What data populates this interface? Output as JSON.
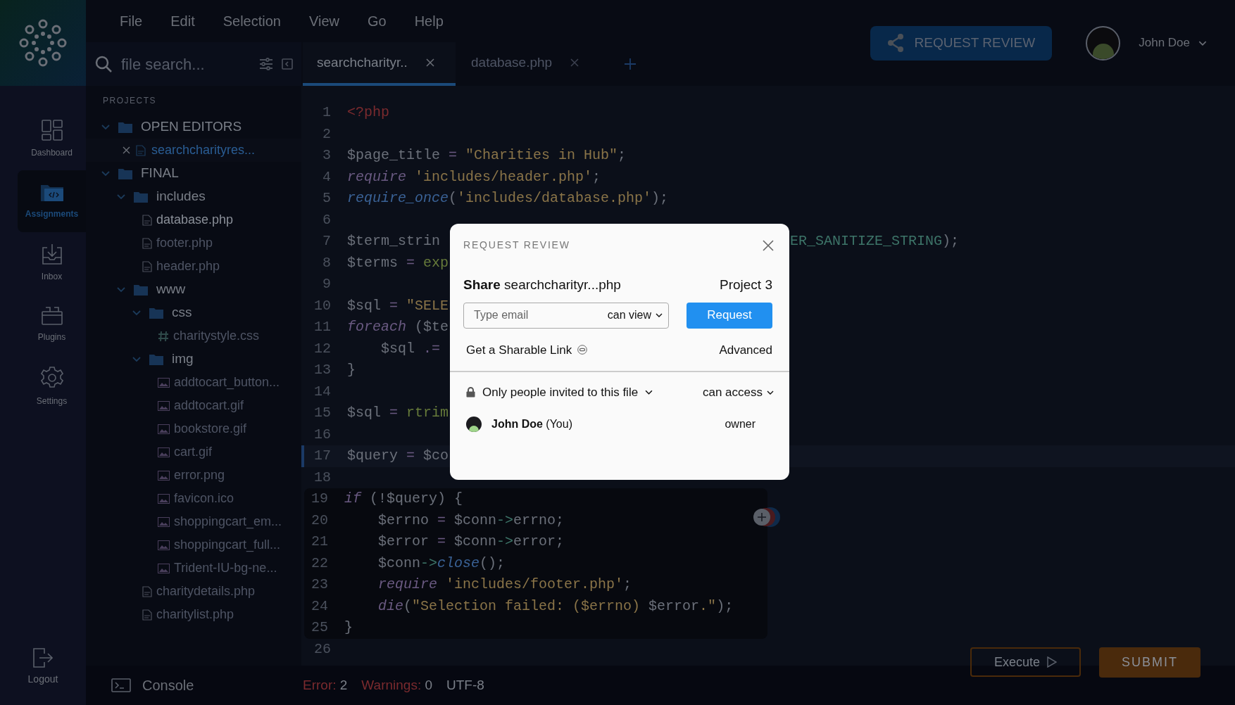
{
  "nav": {
    "items": [
      {
        "label": "Dashboard",
        "selected": false
      },
      {
        "label": "Assignments",
        "selected": true
      },
      {
        "label": "Inbox",
        "selected": false
      },
      {
        "label": "Plugins",
        "selected": false
      },
      {
        "label": "Settings",
        "selected": false
      }
    ],
    "logout": "Logout"
  },
  "menu": [
    "File",
    "Edit",
    "Selection",
    "View",
    "Go",
    "Help"
  ],
  "header": {
    "request_button": "REQUEST REVIEW",
    "user_name": "John Doe"
  },
  "search": {
    "placeholder": "file search..."
  },
  "tabs": [
    {
      "label": "searchcharityr..",
      "selected": true
    },
    {
      "label": "database.php",
      "selected": false
    }
  ],
  "tree": {
    "heading": "PROJECTS",
    "items": [
      {
        "kind": "folder",
        "label": "OPEN EDITORS",
        "expanded": true,
        "children": [
          {
            "kind": "open_editor",
            "label": "searchcharityres...",
            "selected": true
          }
        ]
      },
      {
        "kind": "folder",
        "label": "FINAL",
        "expanded": true,
        "children": [
          {
            "kind": "folder",
            "label": "includes",
            "expanded": true,
            "children": [
              {
                "kind": "php",
                "label": "database.php",
                "bright": true
              },
              {
                "kind": "php",
                "label": "footer.php",
                "bright": false
              },
              {
                "kind": "php",
                "label": "header.php",
                "bright": false
              }
            ]
          },
          {
            "kind": "folder",
            "label": "www",
            "expanded": true,
            "children": [
              {
                "kind": "folder",
                "label": "css",
                "expanded": true,
                "children": [
                  {
                    "kind": "css",
                    "label": "charitystyle.css",
                    "bright": false
                  }
                ]
              },
              {
                "kind": "folder",
                "label": "img",
                "expanded": true,
                "children": [
                  {
                    "kind": "image",
                    "label": "addtocart_button...",
                    "bright": false
                  },
                  {
                    "kind": "image",
                    "label": "addtocart.gif",
                    "bright": false
                  },
                  {
                    "kind": "image",
                    "label": "bookstore.gif",
                    "bright": false
                  },
                  {
                    "kind": "image",
                    "label": "cart.gif",
                    "bright": false
                  },
                  {
                    "kind": "image",
                    "label": "error.png",
                    "bright": false
                  },
                  {
                    "kind": "image",
                    "label": "favicon.ico",
                    "bright": false
                  },
                  {
                    "kind": "image",
                    "label": "shoppingcart_em...",
                    "bright": false
                  },
                  {
                    "kind": "image",
                    "label": "shoppingcart_full...",
                    "bright": false
                  },
                  {
                    "kind": "image",
                    "label": "Trident-IU-bg-ne...",
                    "bright": false
                  }
                ]
              },
              {
                "kind": "php",
                "label": "charitydetails.php",
                "bright": false
              },
              {
                "kind": "php",
                "label": "charitylist.php",
                "bright": false
              }
            ]
          }
        ]
      }
    ]
  },
  "code": [
    {
      "number": "1",
      "tokens": [
        {
          "kind": "tag",
          "text": "<?php"
        }
      ]
    },
    {
      "number": "2"
    },
    {
      "number": "3",
      "tokens": [
        {
          "kind": "var",
          "text": "$page_title"
        },
        {
          "kind": "op",
          "text": " ="
        },
        {
          "kind": "str",
          "text": " \"Charities in Hub\""
        },
        {
          "kind": "plain",
          "text": ";"
        }
      ]
    },
    {
      "number": "4",
      "tokens": [
        {
          "kind": "kw",
          "text": "require"
        },
        {
          "kind": "str",
          "text": " 'includes/header.php'"
        },
        {
          "kind": "plain",
          "text": ";"
        }
      ]
    },
    {
      "number": "5",
      "tokens": [
        {
          "kind": "fn",
          "text": "require_once"
        },
        {
          "kind": "plain",
          "text": "("
        },
        {
          "kind": "str",
          "text": "'includes/database.php'"
        },
        {
          "kind": "plain",
          "text": ");"
        }
      ]
    },
    {
      "number": "6"
    },
    {
      "number": "7",
      "tokens": [
        {
          "kind": "var",
          "text": "$term_strin"
        }
      ],
      "right_tokens": [
        {
          "kind": "const",
          "text": "ER_SANITIZE_STRING"
        },
        {
          "kind": "plain",
          "text": ");"
        }
      ]
    },
    {
      "number": "8",
      "tokens": [
        {
          "kind": "var",
          "text": "$terms"
        },
        {
          "kind": "op",
          "text": " ="
        },
        {
          "kind": "call",
          "text": " exp"
        }
      ]
    },
    {
      "number": "9"
    },
    {
      "number": "10",
      "tokens": [
        {
          "kind": "var",
          "text": "$sql"
        },
        {
          "kind": "op",
          "text": " ="
        },
        {
          "kind": "str",
          "text": " \"SELE"
        }
      ]
    },
    {
      "number": "11",
      "tokens": [
        {
          "kind": "kw",
          "text": "foreach"
        },
        {
          "kind": "plain",
          "text": " ($te"
        }
      ]
    },
    {
      "number": "12",
      "indented": true,
      "tokens": [
        {
          "kind": "var",
          "text": "$sql"
        },
        {
          "kind": "op",
          "text": " .="
        }
      ]
    },
    {
      "number": "13",
      "tokens": [
        {
          "kind": "plain",
          "text": "}"
        }
      ]
    },
    {
      "number": "14"
    },
    {
      "number": "15",
      "tokens": [
        {
          "kind": "var",
          "text": "$sql"
        },
        {
          "kind": "op",
          "text": " ="
        },
        {
          "kind": "call",
          "text": " rtrim"
        }
      ]
    },
    {
      "number": "16"
    },
    {
      "number": "17",
      "current": true,
      "tokens": [
        {
          "kind": "var",
          "text": "$query"
        },
        {
          "kind": "op",
          "text": " ="
        },
        {
          "kind": "var",
          "text": " $co"
        }
      ]
    },
    {
      "number": "18"
    },
    {
      "number": "19",
      "block": true,
      "tokens": [
        {
          "kind": "kw",
          "text": "if"
        },
        {
          "kind": "plain",
          "text": " (!"
        },
        {
          "kind": "var",
          "text": "$query"
        },
        {
          "kind": "plain",
          "text": ") {"
        }
      ]
    },
    {
      "number": "20",
      "block": true,
      "indented": true,
      "tokens": [
        {
          "kind": "var",
          "text": "$errno"
        },
        {
          "kind": "op",
          "text": " ="
        },
        {
          "kind": "var",
          "text": " $conn"
        },
        {
          "kind": "arrow",
          "text": "->"
        },
        {
          "kind": "var",
          "text": "errno"
        },
        {
          "kind": "plain",
          "text": ";"
        }
      ]
    },
    {
      "number": "21",
      "block": true,
      "indented": true,
      "tokens": [
        {
          "kind": "var",
          "text": "$error"
        },
        {
          "kind": "op",
          "text": " ="
        },
        {
          "kind": "var",
          "text": " $conn"
        },
        {
          "kind": "arrow",
          "text": "->"
        },
        {
          "kind": "var",
          "text": "error"
        },
        {
          "kind": "plain",
          "text": ";"
        }
      ]
    },
    {
      "number": "22",
      "block": true,
      "indented": true,
      "tokens": [
        {
          "kind": "var",
          "text": "$conn"
        },
        {
          "kind": "arrow",
          "text": "->"
        },
        {
          "kind": "fn",
          "text": "close"
        },
        {
          "kind": "plain",
          "text": "();"
        }
      ]
    },
    {
      "number": "23",
      "block": true,
      "indented": true,
      "tokens": [
        {
          "kind": "kw",
          "text": "require"
        },
        {
          "kind": "str",
          "text": " 'includes/footer.php'"
        },
        {
          "kind": "plain",
          "text": ";"
        }
      ]
    },
    {
      "number": "24",
      "block": true,
      "indented": true,
      "tokens": [
        {
          "kind": "kw",
          "text": "die"
        },
        {
          "kind": "plain",
          "text": "("
        },
        {
          "kind": "str",
          "text": "\"Selection failed: ($errno)"
        },
        {
          "kind": "var",
          "text": " $error"
        },
        {
          "kind": "str",
          "text": ".\""
        },
        {
          "kind": "plain",
          "text": ");"
        }
      ]
    },
    {
      "number": "25",
      "block": true,
      "tokens": [
        {
          "kind": "plain",
          "text": "}"
        }
      ]
    },
    {
      "number": "26"
    }
  ],
  "console": "Console",
  "status": {
    "error_label": "Error:",
    "error_count": "2",
    "warnings_label": "Warnings:",
    "warnings_count": "0",
    "encoding": "UTF-8"
  },
  "actions": {
    "execute": "Execute",
    "submit": "SUBMIT"
  },
  "dialog": {
    "title": "REQUEST REVIEW",
    "share": "**Share** searchcharityr...php",
    "project": "Project 3",
    "email_placeholder": "Type email",
    "permission": "can view",
    "request_button": "Request",
    "link": "Get a Sharable Link",
    "advanced": "Advanced",
    "access": "Only people invited to this file",
    "access_level": "can access",
    "people": [
      {
        "name": "**John Doe** (You)",
        "role": "owner"
      }
    ]
  }
}
